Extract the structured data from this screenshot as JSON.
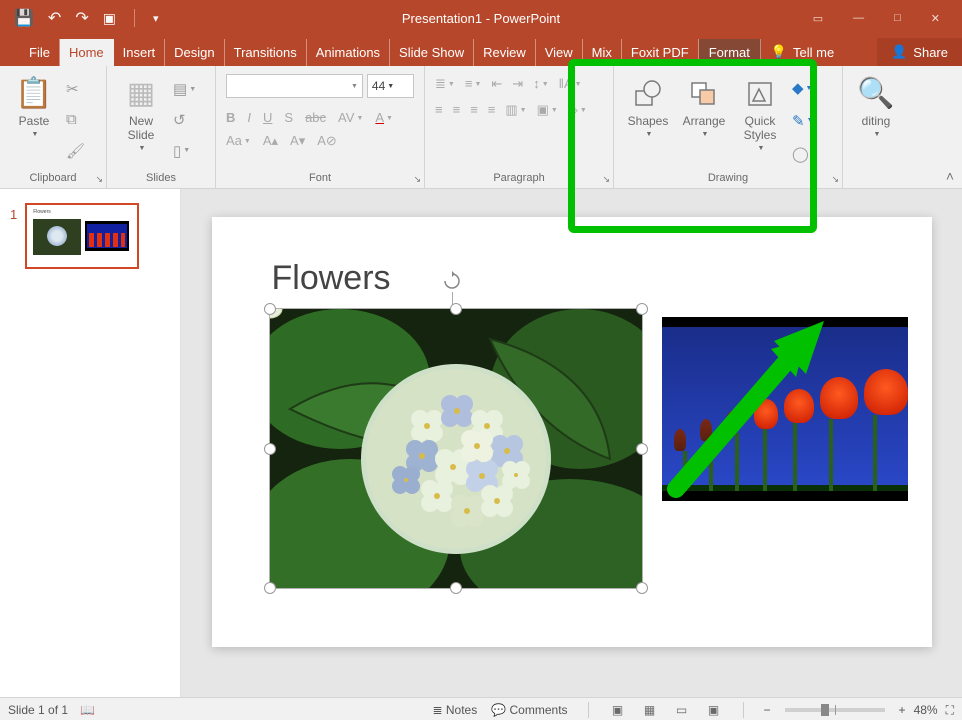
{
  "titlebar": {
    "title": "Presentation1 - PowerPoint"
  },
  "tabs": {
    "file": "File",
    "home": "Home",
    "insert": "Insert",
    "design": "Design",
    "transitions": "Transitions",
    "animations": "Animations",
    "slideshow": "Slide Show",
    "review": "Review",
    "view": "View",
    "mix": "Mix",
    "foxit": "Foxit PDF",
    "format": "Format",
    "tellme": "Tell me",
    "share": "Share"
  },
  "ribbon": {
    "clipboard": {
      "paste": "Paste",
      "label": "Clipboard"
    },
    "slides": {
      "new_slide": "New\nSlide",
      "label": "Slides"
    },
    "font": {
      "size": "44",
      "label": "Font"
    },
    "paragraph": {
      "label": "Paragraph"
    },
    "drawing": {
      "shapes": "Shapes",
      "arrange": "Arrange",
      "quick": "Quick\nStyles",
      "label": "Drawing"
    },
    "editing": {
      "btn": "diting"
    }
  },
  "side": {
    "slide_num": "1"
  },
  "slide": {
    "title": "Flowers"
  },
  "status": {
    "slide": "Slide 1 of 1",
    "notes": "Notes",
    "comments": "Comments",
    "zoom": "48%"
  }
}
